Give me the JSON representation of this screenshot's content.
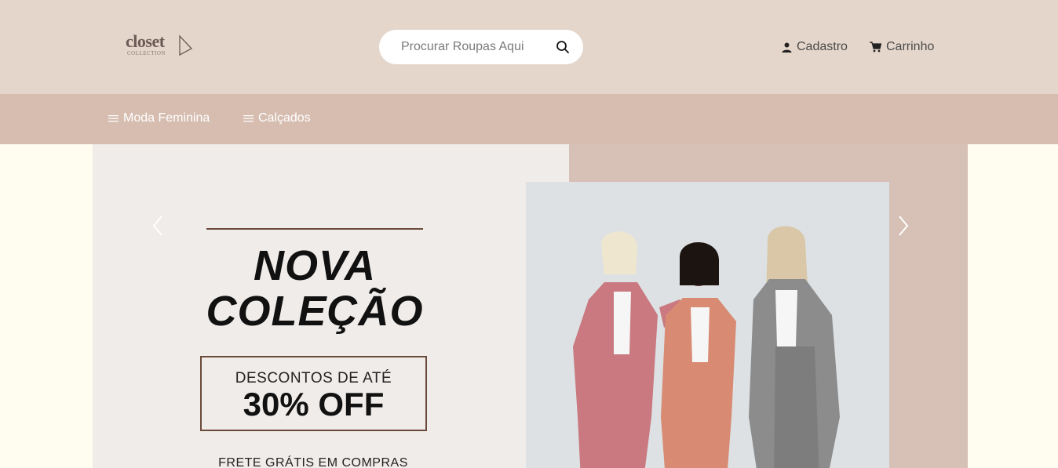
{
  "header": {
    "logo_text": "closet",
    "logo_sub": "COLLECTION",
    "search_placeholder": "Procurar Roupas Aqui",
    "signup_label": "Cadastro",
    "cart_label": "Carrinho"
  },
  "nav": {
    "items": [
      {
        "label": "Moda Feminina"
      },
      {
        "label": "Calçados"
      }
    ]
  },
  "hero": {
    "headline_line1": "NOVA",
    "headline_line2": "COLEÇÃO",
    "discount_label": "DESCONTOS DE ATÉ",
    "discount_value": "30% OFF",
    "shipping_text": "FRETE GRÁTIS EM COMPRAS"
  },
  "colors": {
    "topbar": "#e4d6cb",
    "navbar": "#d6bdb0",
    "page_bg": "#fffdf0",
    "pink_suit": "#c9797f",
    "salmon_suit": "#d88a72",
    "gray_suit": "#8c8c8c"
  }
}
